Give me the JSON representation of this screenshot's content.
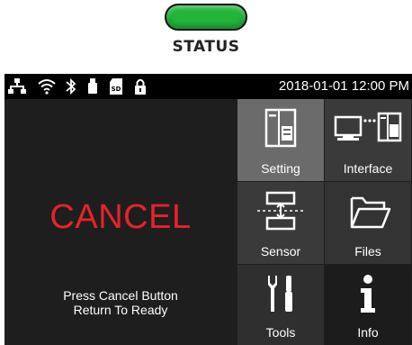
{
  "status_indicator": {
    "label": "STATUS",
    "color": "#22b53a"
  },
  "status_bar": {
    "icons": [
      "network-icon",
      "wifi-icon",
      "bluetooth-icon",
      "usb-icon",
      "sd-card-icon",
      "lock-icon"
    ],
    "datetime": "2018-01-01 12:00 PM"
  },
  "main": {
    "message": "CANCEL",
    "message_color": "#e8222a",
    "hint_line1": "Press Cancel Button",
    "hint_line2": "Return To Ready"
  },
  "menu": {
    "setting": {
      "label": "Setting",
      "icon": "setting-icon"
    },
    "interface": {
      "label": "Interface",
      "icon": "interface-icon"
    },
    "sensor": {
      "label": "Sensor",
      "icon": "sensor-icon"
    },
    "files": {
      "label": "Files",
      "icon": "folder-icon"
    },
    "tools": {
      "label": "Tools",
      "icon": "tools-icon"
    },
    "info": {
      "label": "Info",
      "icon": "info-icon"
    }
  }
}
